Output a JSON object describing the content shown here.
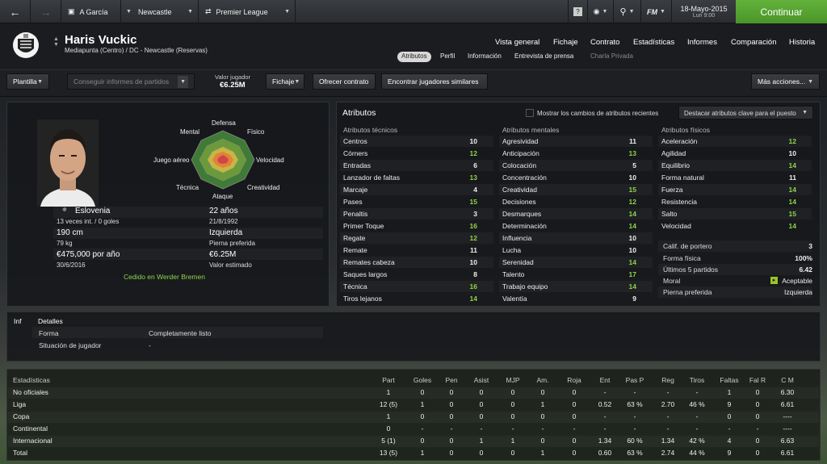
{
  "topbar": {
    "manager": "A García",
    "club": "Newcastle",
    "competition": "Premier League",
    "date": "18-Mayo-2015",
    "day": "Lun 9:00",
    "continue": "Continuar",
    "fm": "FM"
  },
  "player": {
    "name": "Haris Vuckic",
    "position": "Mediapunta (Centro) / DC - Newcastle (Reservas)"
  },
  "nav": [
    "Vista general",
    "Fichaje",
    "Contrato",
    "Estadísticas",
    "Informes",
    "Comparación",
    "Historia"
  ],
  "subnav": [
    "Atributos",
    "Perfil",
    "Información",
    "Entrevista de prensa",
    "Charla Privada"
  ],
  "toolbar": {
    "squad": "Plantilla",
    "scout": "Conseguir informes de partidos",
    "value_label": "Valor jugador",
    "value": "€6.25M",
    "ficha": "Fichaje",
    "offer": "Ofrecer contrato",
    "similar": "Encontrar jugadores similares",
    "more": "Más acciones..."
  },
  "profile": {
    "nation": "Eslovenia",
    "caps": "13 veces int. / 0 goles",
    "height": "190 cm",
    "weight": "79 kg",
    "wage": "€475,000 por año",
    "contract": "30/6/2016",
    "age": "22 años",
    "dob": "21/8/1992",
    "foot": "Izquierda",
    "foot_label": "Pierna preferida",
    "value": "€6.25M",
    "value_label": "Valor estimado",
    "loan": "Cedido en Werder Bremen"
  },
  "radar": {
    "top": "Defensa",
    "tl": "Mental",
    "tr": "Físico",
    "l": "Juego aéreo",
    "r": "Velocidad",
    "bl": "Técnica",
    "br": "Creatividad",
    "bottom": "Ataque"
  },
  "attrs": {
    "title": "Atributos",
    "show_changes": "Mostrar los cambios de atributos recientes",
    "highlight": "Destacar atributos clave para el puesto",
    "tech_title": "Atributos técnicos",
    "mental_title": "Atributos mentales",
    "phys_title": "Atributos físicos",
    "technical": [
      [
        "Centros",
        "10"
      ],
      [
        "Córners",
        "12"
      ],
      [
        "Entradas",
        "6"
      ],
      [
        "Lanzador de faltas",
        "13"
      ],
      [
        "Marcaje",
        "4"
      ],
      [
        "Pases",
        "15"
      ],
      [
        "Penaltis",
        "3"
      ],
      [
        "Primer Toque",
        "16"
      ],
      [
        "Regate",
        "12"
      ],
      [
        "Remate",
        "11"
      ],
      [
        "Remates cabeza",
        "10"
      ],
      [
        "Saques largos",
        "8"
      ],
      [
        "Técnica",
        "16"
      ],
      [
        "Tiros lejanos",
        "14"
      ]
    ],
    "mental": [
      [
        "Agresividad",
        "11"
      ],
      [
        "Anticipación",
        "13"
      ],
      [
        "Colocación",
        "5"
      ],
      [
        "Concentración",
        "10"
      ],
      [
        "Creatividad",
        "15"
      ],
      [
        "Decisiones",
        "12"
      ],
      [
        "Desmarques",
        "14"
      ],
      [
        "Determinación",
        "14"
      ],
      [
        "Influencia",
        "10"
      ],
      [
        "Lucha",
        "10"
      ],
      [
        "Serenidad",
        "14"
      ],
      [
        "Talento",
        "17"
      ],
      [
        "Trabajo equipo",
        "14"
      ],
      [
        "Valentía",
        "9"
      ]
    ],
    "physical": [
      [
        "Aceleración",
        "12"
      ],
      [
        "Agilidad",
        "10"
      ],
      [
        "Equilibrio",
        "14"
      ],
      [
        "Forma natural",
        "11"
      ],
      [
        "Fuerza",
        "14"
      ],
      [
        "Resistencia",
        "14"
      ],
      [
        "Salto",
        "15"
      ],
      [
        "Velocidad",
        "14"
      ]
    ],
    "extra": [
      [
        "Calif. de portero",
        "3"
      ],
      [
        "Forma física",
        "100%"
      ],
      [
        "Últimos 5 partidos",
        "6.42"
      ],
      [
        "Moral",
        "Aceptable"
      ],
      [
        "Pierna preferida",
        "Izquierda"
      ]
    ]
  },
  "info": {
    "tab1": "Inf",
    "tab2": "Detalles",
    "forma_label": "Forma",
    "forma": "Completamente listo",
    "sit_label": "Situación de jugador",
    "sit": "-"
  },
  "stats": {
    "headers": [
      "Estadísticas",
      "Part",
      "Goles",
      "Pen",
      "Asist",
      "MJP",
      "Am.",
      "Roja",
      "Ent",
      "Pas P",
      "Reg",
      "Tiros",
      "Faltas",
      "Fal R",
      "C M"
    ],
    "rows": [
      [
        "No oficiales",
        "1",
        "0",
        "0",
        "0",
        "0",
        "0",
        "0",
        "-",
        "-",
        "-",
        "-",
        "1",
        "0",
        "6.30"
      ],
      [
        "Liga",
        "12 (5)",
        "1",
        "0",
        "0",
        "0",
        "1",
        "0",
        "0.52",
        "63 %",
        "2.70",
        "46 %",
        "9",
        "0",
        "6.61"
      ],
      [
        "Copa",
        "1",
        "0",
        "0",
        "0",
        "0",
        "0",
        "0",
        "-",
        "-",
        "-",
        "-",
        "0",
        "0",
        "----"
      ],
      [
        "Continental",
        "0",
        "-",
        "-",
        "-",
        "-",
        "-",
        "-",
        "-",
        "-",
        "-",
        "-",
        "-",
        "-",
        "----"
      ],
      [
        "Internacional",
        "5 (1)",
        "0",
        "0",
        "1",
        "1",
        "0",
        "0",
        "1.34",
        "60 %",
        "1.34",
        "42 %",
        "4",
        "0",
        "6.63"
      ],
      [
        "Total",
        "13 (5)",
        "1",
        "0",
        "0",
        "0",
        "1",
        "0",
        "0.60",
        "63 %",
        "2.74",
        "44 %",
        "9",
        "0",
        "6.61"
      ]
    ]
  }
}
